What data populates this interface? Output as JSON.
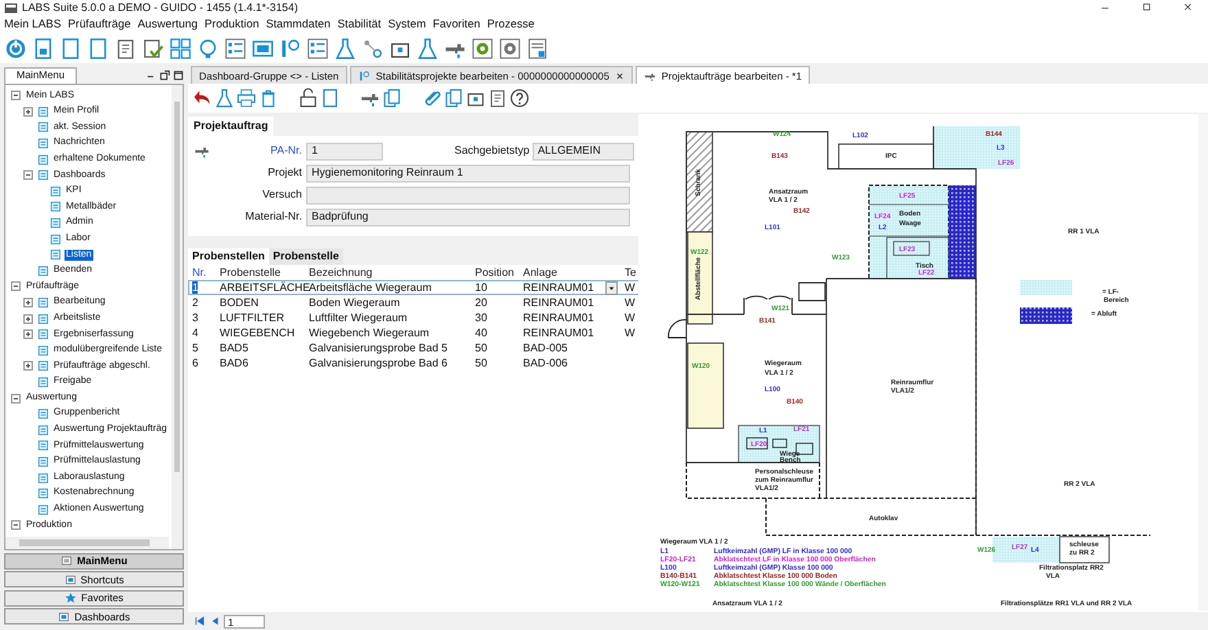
{
  "window": {
    "title": "LABS Suite 5.0.0 a DEMO - GUIDO - 1455 (1.4.1*-3154)"
  },
  "menu": [
    "Mein LABS",
    "Prüfaufträge",
    "Auswertung",
    "Produktion",
    "Stammdaten",
    "Stabilität",
    "System",
    "Favoriten",
    "Prozesse"
  ],
  "sidebar": {
    "title": "MainMenu",
    "tree": [
      {
        "label": "Mein LABS",
        "expanded": true,
        "selected": false,
        "children": [
          {
            "label": "Mein Profil",
            "expanded": false,
            "selected": false
          },
          {
            "label": "akt. Session",
            "selected": false
          },
          {
            "label": "Nachrichten",
            "selected": false
          },
          {
            "label": "erhaltene Dokumente",
            "selected": false
          },
          {
            "label": "Dashboards",
            "expanded": true,
            "selected": false,
            "children": [
              {
                "label": "KPI",
                "selected": false
              },
              {
                "label": "Metallbäder",
                "selected": false
              },
              {
                "label": "Admin",
                "selected": false
              },
              {
                "label": "Labor",
                "selected": false
              },
              {
                "label": "Listen",
                "selected": true
              }
            ]
          },
          {
            "label": "Beenden",
            "selected": false
          }
        ]
      },
      {
        "label": "Prüfaufträge",
        "expanded": true,
        "selected": false,
        "children": [
          {
            "label": "Bearbeitung",
            "expanded": false,
            "selected": false
          },
          {
            "label": "Arbeitsliste",
            "expanded": false,
            "selected": false
          },
          {
            "label": "Ergebniserfassung",
            "expanded": false,
            "selected": false
          },
          {
            "label": "modulübergreifende Liste",
            "selected": false
          },
          {
            "label": "Prüfaufträge abgeschl.",
            "expanded": false,
            "selected": false
          },
          {
            "label": "Freigabe",
            "selected": false
          }
        ]
      },
      {
        "label": "Auswertung",
        "expanded": true,
        "selected": false,
        "children": [
          {
            "label": "Gruppenbericht",
            "selected": false
          },
          {
            "label": "Auswertung Projektaufträg",
            "selected": false
          },
          {
            "label": "Prüfmittelauswertung",
            "selected": false
          },
          {
            "label": "Prüfmittelauslastung",
            "selected": false
          },
          {
            "label": "Laborauslastung",
            "selected": false
          },
          {
            "label": "Kostenabrechnung",
            "selected": false
          },
          {
            "label": "Aktionen Auswertung",
            "selected": false
          }
        ]
      },
      {
        "label": "Produktion",
        "expanded": true,
        "selected": false
      }
    ],
    "buttons": [
      {
        "label": "MainMenu",
        "selected": true
      },
      {
        "label": "Shortcuts",
        "selected": false
      },
      {
        "label": "Favorites",
        "selected": false
      },
      {
        "label": "Dashboards",
        "selected": false
      }
    ]
  },
  "tabs": [
    {
      "label": "Dashboard-Gruppe <> - Listen",
      "selected": false,
      "closable": false
    },
    {
      "label": "Stabilitätsprojekte bearbeiten - 0000000000000005",
      "selected": false,
      "closable": true
    },
    {
      "label": "Projektaufträge bearbeiten - *1",
      "selected": true,
      "closable": false
    }
  ],
  "section_tab": "Projektauftrag",
  "form": {
    "fields": [
      {
        "label": "PA-Nr.",
        "value": "1",
        "kind": "key"
      },
      {
        "label": "Sachgebietstyp",
        "value": "ALLGEMEIN",
        "kind": "side"
      },
      {
        "label": "Projekt",
        "value": "Hygienemonitoring Reinraum 1",
        "kind": "wide"
      },
      {
        "label": "Versuch",
        "kind": "wide"
      },
      {
        "label": "Material-Nr.",
        "value": "Badprüfung",
        "kind": "wide"
      }
    ]
  },
  "subtabs": [
    {
      "label": "Probenstellen",
      "selected": true
    },
    {
      "label": "Probenstelle",
      "selected": false
    }
  ],
  "table": {
    "columns": [
      "Nr.",
      "Probenstelle",
      "Bezeichnung",
      "Position",
      "Anlage",
      "Te"
    ],
    "rows": [
      {
        "selected": true,
        "cells": [
          "1",
          "ARBEITSFLÄCHE",
          "Arbeitsfläche Wiegeraum",
          "10",
          "REINRAUM01",
          "W"
        ]
      },
      {
        "selected": false,
        "cells": [
          "2",
          "BODEN",
          "Boden Wiegeraum",
          "20",
          "REINRAUM01",
          "W"
        ]
      },
      {
        "selected": false,
        "cells": [
          "3",
          "LUFTFILTER",
          "Luftfilter Wiegeraum",
          "30",
          "REINRAUM01",
          "W"
        ]
      },
      {
        "selected": false,
        "cells": [
          "4",
          "WIEGEBENCH",
          "Wiegebench Wiegeraum",
          "40",
          "REINRAUM01",
          "W"
        ]
      },
      {
        "selected": false,
        "cells": [
          "5",
          "BAD5",
          "Galvanisierungsprobe Bad 5",
          "50",
          "BAD-005"
        ]
      },
      {
        "selected": false,
        "cells": [
          "6",
          "BAD6",
          "Galvanisierungsprobe Bad 6",
          "50",
          "BAD-006"
        ]
      }
    ]
  },
  "floor_plan": {
    "labels": [
      {
        "text": "W124",
        "color": "#2e9a2e"
      },
      {
        "text": "L102",
        "color": "#2b2bd6"
      },
      {
        "text": "IPC",
        "color": "#222222"
      },
      {
        "text": "B144",
        "color": "#a02020"
      },
      {
        "text": "L3",
        "color": "#2b2bd6"
      },
      {
        "text": "LF26",
        "color": "#d020d0"
      },
      {
        "text": "B143",
        "color": "#a02020"
      },
      {
        "text": "Schrank",
        "color": "#222222"
      },
      {
        "text": "Ansatzraum",
        "color": "#222222"
      },
      {
        "text": "VLA 1 / 2",
        "color": "#222222"
      },
      {
        "text": "B142",
        "color": "#a02020"
      },
      {
        "text": "L101",
        "color": "#2b2bd6"
      },
      {
        "text": "LF25",
        "color": "#d020d0"
      },
      {
        "text": "LF24",
        "color": "#d020d0"
      },
      {
        "text": "Boden",
        "color": "#222222"
      },
      {
        "text": "Waage",
        "color": "#222222"
      },
      {
        "text": "L2",
        "color": "#2b2bd6"
      },
      {
        "text": "LF23",
        "color": "#d020d0"
      },
      {
        "text": "Tisch",
        "color": "#222222"
      },
      {
        "text": "LF22",
        "color": "#d020d0"
      },
      {
        "text": "RR 1 VLA",
        "color": "#222222"
      },
      {
        "text": "W122",
        "color": "#2e9a2e"
      },
      {
        "text": "Abstellfläche",
        "color": "#222222"
      },
      {
        "text": "W123",
        "color": "#2e9a2e"
      },
      {
        "text": "= LF-",
        "color": "#222222"
      },
      {
        "text": "Bereich",
        "color": "#222222"
      },
      {
        "text": "= Abluft",
        "color": "#222222"
      },
      {
        "text": "W121",
        "color": "#2e9a2e"
      },
      {
        "text": "B141",
        "color": "#a02020"
      },
      {
        "text": "W120",
        "color": "#2e9a2e"
      },
      {
        "text": "Wiegeraum",
        "color": "#222222"
      },
      {
        "text": "VLA 1 / 2",
        "color": "#222222"
      },
      {
        "text": "L100",
        "color": "#2b2bd6"
      },
      {
        "text": "B140",
        "color": "#a02020"
      },
      {
        "text": "Reinraumflur",
        "color": "#222222"
      },
      {
        "text": "VLA1/2",
        "color": "#222222"
      },
      {
        "text": "L1",
        "color": "#2b2bd6"
      },
      {
        "text": "LF21",
        "color": "#d020d0"
      },
      {
        "text": "LF20",
        "color": "#d020d0"
      },
      {
        "text": "Wiege",
        "color": "#222222"
      },
      {
        "text": "Bench",
        "color": "#222222"
      },
      {
        "text": "Personalschleuse",
        "color": "#222222"
      },
      {
        "text": "zum Reinraumflur",
        "color": "#222222"
      },
      {
        "text": "VLA1/2",
        "color": "#222222"
      },
      {
        "text": "RR 2 VLA",
        "color": "#222222"
      },
      {
        "text": "Autoklav",
        "color": "#222222"
      },
      {
        "text": "W126",
        "color": "#2e9a2e"
      },
      {
        "text": "LF27",
        "color": "#d020d0"
      },
      {
        "text": "L4",
        "color": "#2b2bd6"
      },
      {
        "text": "schleuse",
        "color": "#222222"
      },
      {
        "text": "zu RR 2",
        "color": "#222222"
      },
      {
        "text": "Filtrationsplatz RR2",
        "color": "#222222"
      },
      {
        "text": "VLA",
        "color": "#222222"
      },
      {
        "text": "Ansatzraum VLA 1 / 2",
        "color": "#222222"
      },
      {
        "text": "Filtrationsplätze RR1 VLA und RR 2 VLA",
        "color": "#222222"
      }
    ],
    "legend": {
      "title": "Wiegeraum VLA 1 / 2",
      "rows": [
        {
          "code": "L1",
          "text": "Luftkeimzahl (GMP) LF in Klasse 100 000",
          "color": "#2b2bd6"
        },
        {
          "code": "LF20-LF21",
          "text": "Abklatschtest LF in Klasse 100 000 Oberflächen",
          "color": "#d020d0"
        },
        {
          "code": "L100",
          "text": "Luftkeimzahl (GMP) Klasse 100 000",
          "color": "#2b2bd6"
        },
        {
          "code": "B140-B141",
          "text": "Abklatschtest Klasse 100 000 Boden",
          "color": "#a02020"
        },
        {
          "code": "W120-W121",
          "text": "Abklatschtest Klasse 100 000 Wände / Oberflächen",
          "color": "#2e9a2e"
        }
      ]
    }
  },
  "pager": {
    "value": "1"
  }
}
